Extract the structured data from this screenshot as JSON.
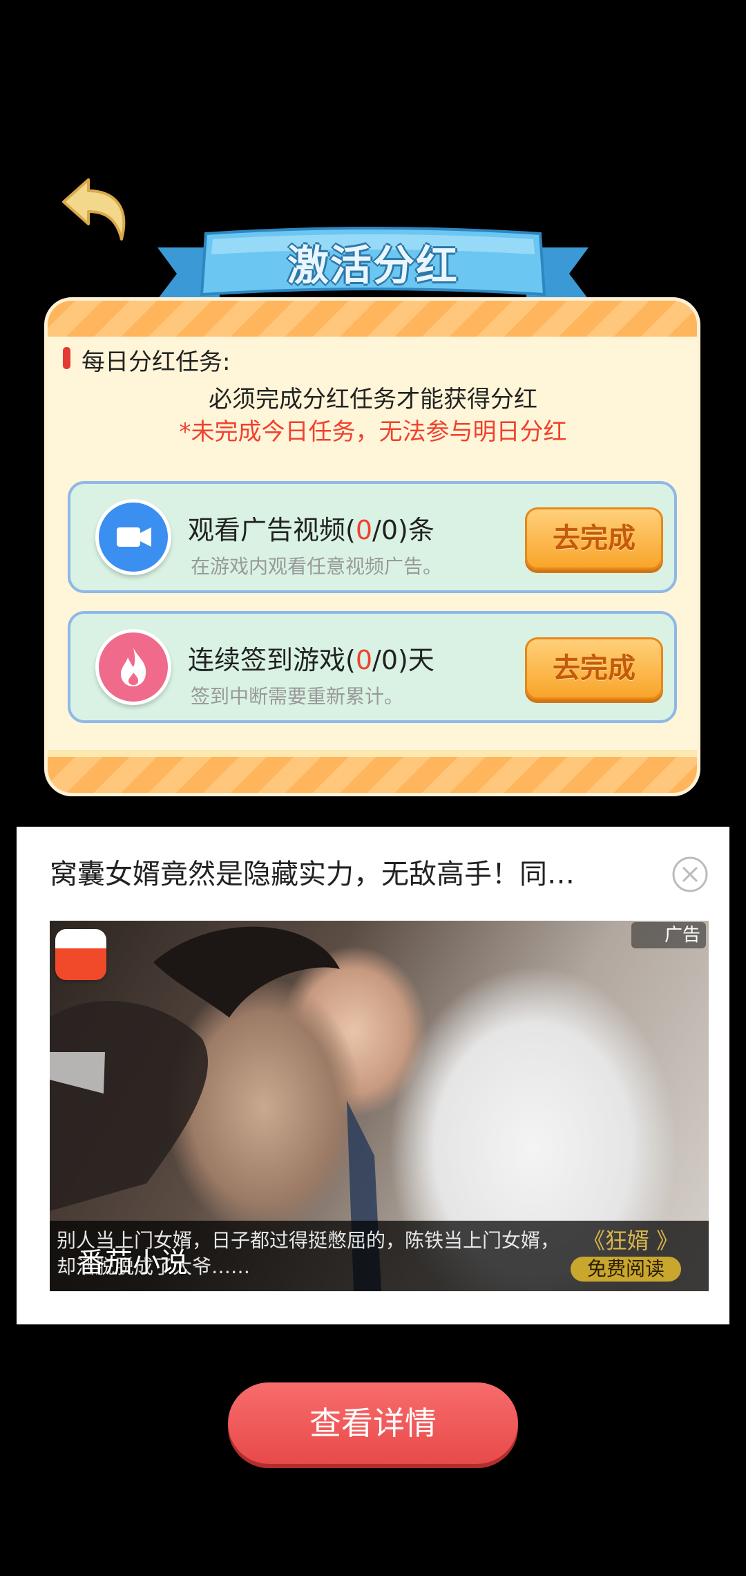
{
  "page": {
    "title": "激活分红"
  },
  "daily": {
    "label": "每日分红任务:",
    "notice_line1": "必须完成分红任务才能获得分红",
    "notice_line2": "*未完成今日任务，无法参与明日分红"
  },
  "tasks": [
    {
      "title_prefix": "观看广告视频(",
      "done": "0",
      "title_suffix": "/0)条",
      "subtitle": "在游戏内观看任意视频广告。",
      "button_label": "去完成",
      "icon": "video-camera-icon",
      "icon_color": "#3b8ff0"
    },
    {
      "title_prefix": "连续签到游戏(",
      "done": "0",
      "title_suffix": "/0)天",
      "subtitle": "签到中断需要重新累计。",
      "button_label": "去完成",
      "icon": "flame-icon",
      "icon_color": "#f06a8c"
    }
  ],
  "ad": {
    "headline": "窝囊女婿竟然是隐藏实力，无敌高手！同…",
    "badge": "广告",
    "description": "别人当上门女婿，日子都过得挺憋屈的，陈铁当上门女婿，却活脱脱成了大爷……",
    "book_title": "《狂婿 》",
    "free_read_label": "免费阅读",
    "brand": "番茄小说"
  },
  "detail_button": {
    "label": "查看详情"
  },
  "colors": {
    "accent_red": "#f0412e",
    "button_orange": "#f9a52a",
    "detail_red": "#e84a4a",
    "ribbon_blue": "#5fb6ea"
  }
}
